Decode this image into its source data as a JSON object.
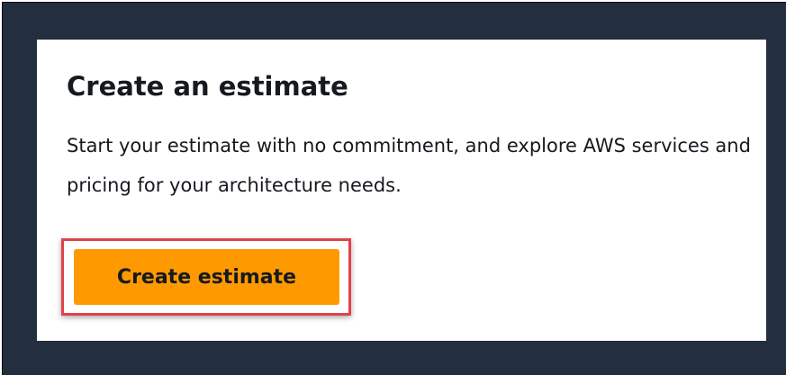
{
  "card": {
    "title": "Create an estimate",
    "description": "Start your estimate with no commitment, and explore AWS services and pricing for your architecture needs.",
    "primary_button_label": "Create estimate"
  },
  "colors": {
    "frame_background": "#232f3e",
    "card_background": "#ffffff",
    "button_background": "#ff9900",
    "highlight_border": "#e0424b",
    "text": "#16191f"
  }
}
